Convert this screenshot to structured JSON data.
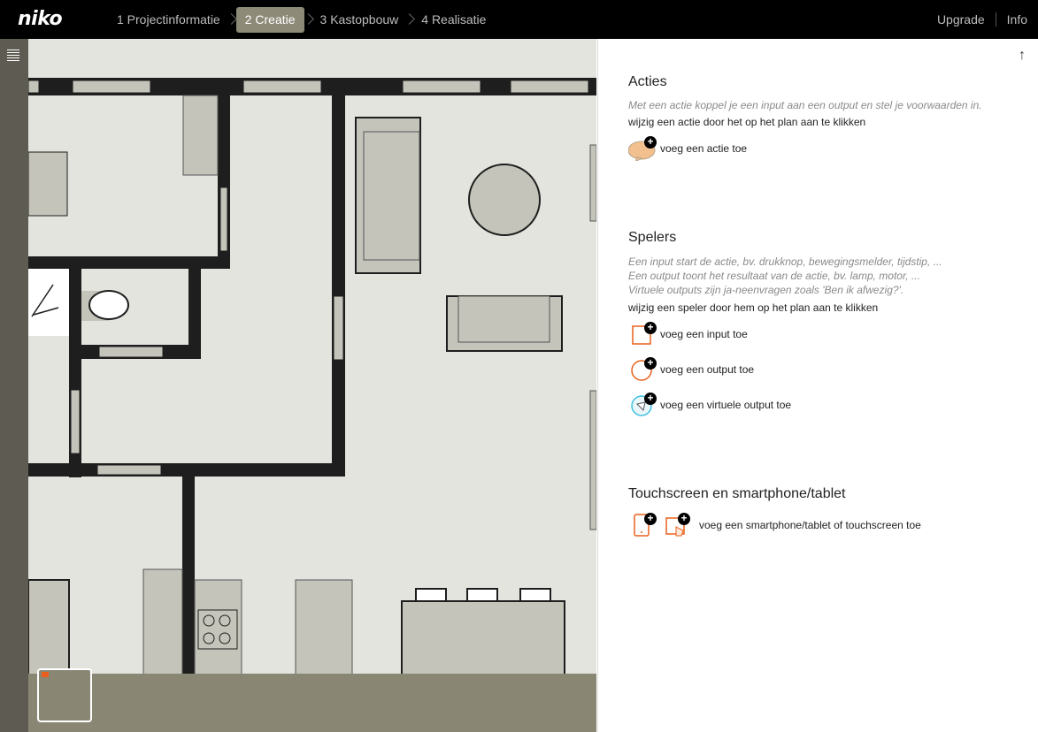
{
  "app": {
    "logo": "niko"
  },
  "steps": [
    {
      "label": "1 Projectinformatie"
    },
    {
      "label": "2 Creatie"
    },
    {
      "label": "3 Kastopbouw"
    },
    {
      "label": "4 Realisatie"
    }
  ],
  "topright": {
    "upgrade": "Upgrade",
    "info": "Info"
  },
  "panel": {
    "acties": {
      "title": "Acties",
      "hint": "Met een actie koppel je een input aan een output en stel je voorwaarden in.",
      "instruction": "wijzig een actie door het op het plan aan te klikken",
      "add_label": "voeg een actie toe"
    },
    "spelers": {
      "title": "Spelers",
      "hint1": "Een input start de actie, bv. drukknop, bewegingsmelder, tijdstip, ...",
      "hint2": "Een output toont het resultaat van de actie, bv. lamp, motor, ...",
      "hint3": "Virtuele outputs zijn ja-neenvragen zoals 'Ben ik afwezig?'.",
      "instruction": "wijzig een speler door hem op het plan aan te klikken",
      "add_input": "voeg een input toe",
      "add_output": "voeg een output toe",
      "add_virtual": "voeg een virtuele output toe"
    },
    "touch": {
      "title": "Touchscreen en smartphone/tablet",
      "add_label": "voeg een smartphone/tablet of touchscreen toe"
    }
  },
  "colors": {
    "accent": "#e8601c",
    "active_step": "#8d8a78",
    "wall": "#1e1e1e",
    "floor": "#e4e4df",
    "furniture": "#c4c4bb",
    "sidebar": "#5e5c52"
  }
}
